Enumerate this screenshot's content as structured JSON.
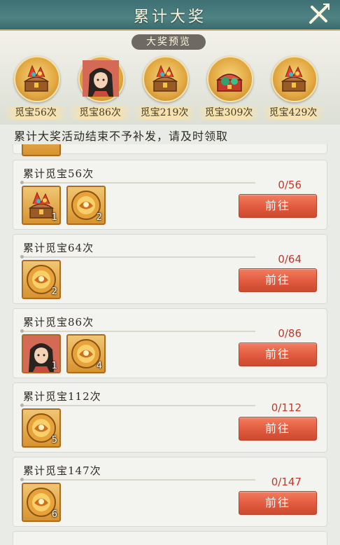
{
  "header": {
    "title": "累计大奖"
  },
  "preview": {
    "label": "大奖预览",
    "rewards": [
      {
        "icon": "treasure-chest-icon",
        "caption": "觅宝56次"
      },
      {
        "icon": "hero-portrait-icon",
        "caption": "觅宝86次"
      },
      {
        "icon": "treasure-chest-icon",
        "caption": "觅宝219次"
      },
      {
        "icon": "jade-chest-icon",
        "caption": "觅宝309次"
      },
      {
        "icon": "treasure-chest-icon",
        "caption": "觅宝429次"
      }
    ]
  },
  "notice": "累计大奖活动结束不予补发，请及时领取",
  "tasks": [
    {
      "title": "累计觅宝56次",
      "progress": "0/56",
      "button": "前往",
      "items": [
        {
          "icon": "treasure-chest-icon",
          "qty": "1"
        },
        {
          "icon": "orb-icon",
          "qty": "2"
        }
      ]
    },
    {
      "title": "累计觅宝64次",
      "progress": "0/64",
      "button": "前往",
      "items": [
        {
          "icon": "orb-icon",
          "qty": "2"
        }
      ]
    },
    {
      "title": "累计觅宝86次",
      "progress": "0/86",
      "button": "前往",
      "items": [
        {
          "icon": "hero-portrait-icon",
          "qty": "1"
        },
        {
          "icon": "orb-icon",
          "qty": "4"
        }
      ]
    },
    {
      "title": "累计觅宝112次",
      "progress": "0/112",
      "button": "前往",
      "items": [
        {
          "icon": "orb-icon",
          "qty": "5"
        }
      ]
    },
    {
      "title": "累计觅宝147次",
      "progress": "0/147",
      "button": "前往",
      "items": [
        {
          "icon": "orb-icon",
          "qty": "6"
        }
      ]
    }
  ],
  "colors": {
    "header": "#4f8383",
    "button": "#e05a3e",
    "progress": "#c0392b",
    "item_frame": "#d8932f"
  }
}
